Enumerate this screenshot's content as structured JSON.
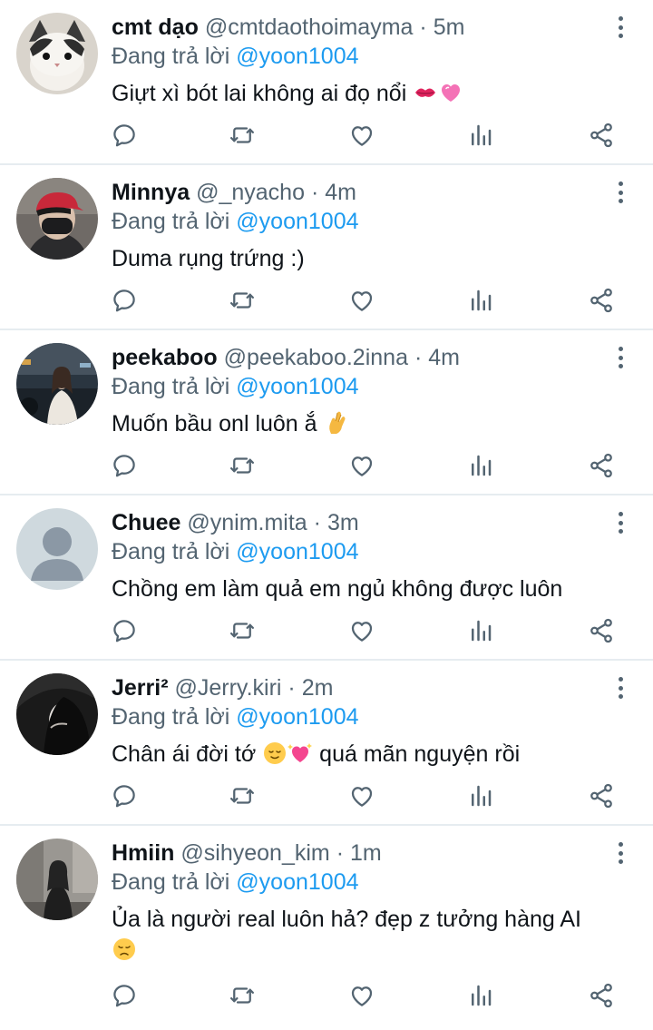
{
  "reply_prefix": "Đang trả lời",
  "tweets": [
    {
      "name": "cmt dạo",
      "handle": "@cmtdaothoimayma",
      "sep": "·",
      "time": "5m",
      "mention": "@yoon1004",
      "text": "Giựt xì bót lai không ai đọ nổi",
      "emojis": [
        "kiss-mark",
        "pink-heart"
      ],
      "avatar": "cat-photo"
    },
    {
      "name": "Minnya",
      "handle": "@_nyacho",
      "sep": "·",
      "time": "4m",
      "mention": "@yoon1004",
      "text": "Duma rụng trứng :)",
      "emojis": [],
      "avatar": "person-red-cap"
    },
    {
      "name": "peekaboo",
      "handle": "@peekaboo.2inna",
      "sep": "·",
      "time": "4m",
      "mention": "@yoon1004",
      "text": "Muốn bầu onl luôn ắ",
      "emojis": [
        "crossed-fingers"
      ],
      "avatar": "person-night-street"
    },
    {
      "name": "Chuee",
      "handle": "@ynim.mita",
      "sep": "·",
      "time": "3m",
      "mention": "@yoon1004",
      "text": "Chồng em làm quả em ngủ không được luôn",
      "emojis": [],
      "avatar": "default-profile"
    },
    {
      "name": "Jerri²",
      "handle": "@Jerry.kiri",
      "sep": "·",
      "time": "2m",
      "mention": "@yoon1004",
      "text_before": "Chân ái đời tớ",
      "text_after": "quá mãn nguyện rồi",
      "emojis": [
        "relieved-face",
        "sparkling-heart"
      ],
      "avatar": "person-dark-hair"
    },
    {
      "name": "Hmiin",
      "handle": "@sihyeon_kim",
      "sep": "·",
      "time": "1m",
      "mention": "@yoon1004",
      "text": "Ủa là người real luôn hả? đẹp z tưởng hàng AI",
      "emojis": [
        "disappointed-face"
      ],
      "avatar": "person-street"
    }
  ],
  "colors": {
    "name": "#0f1419",
    "secondary": "#536471",
    "mention": "#1d9bf0",
    "divider": "#e6ecf0"
  },
  "action_icons": [
    "reply-icon",
    "retweet-icon",
    "like-icon",
    "views-icon",
    "share-icon"
  ]
}
